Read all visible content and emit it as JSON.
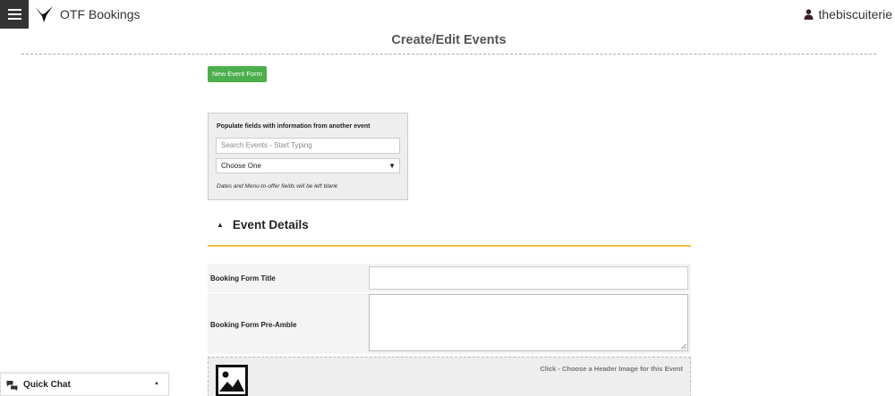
{
  "header": {
    "app_title": "OTF Bookings",
    "username": "thebiscuiterie",
    "menu_icon": "hamburger-icon",
    "logo_icon": "hummingbird-logo",
    "user_icon": "user-icon"
  },
  "page": {
    "title": "Create/Edit Events"
  },
  "toolbar": {
    "new_event_label": "New Event Form"
  },
  "populate": {
    "heading": "Populate fields with information from another event",
    "search_placeholder": "Search Events - Start Typing",
    "select_value": "Choose One",
    "note": "Dates and Menu-to-offer fields will be left blank"
  },
  "event_details": {
    "section_title": "Event Details",
    "booking_form_title_label": "Booking Form Title",
    "booking_form_title_value": "",
    "preamble_label": "Booking Form Pre-Amble",
    "preamble_value": "",
    "header_image_hint": "Click - Choose a Header Image for this Event"
  },
  "quick_chat": {
    "label": "Quick Chat"
  },
  "colors": {
    "accent_green": "#4cae4c",
    "section_underline": "#f0c040",
    "menu_bg": "#333333"
  }
}
